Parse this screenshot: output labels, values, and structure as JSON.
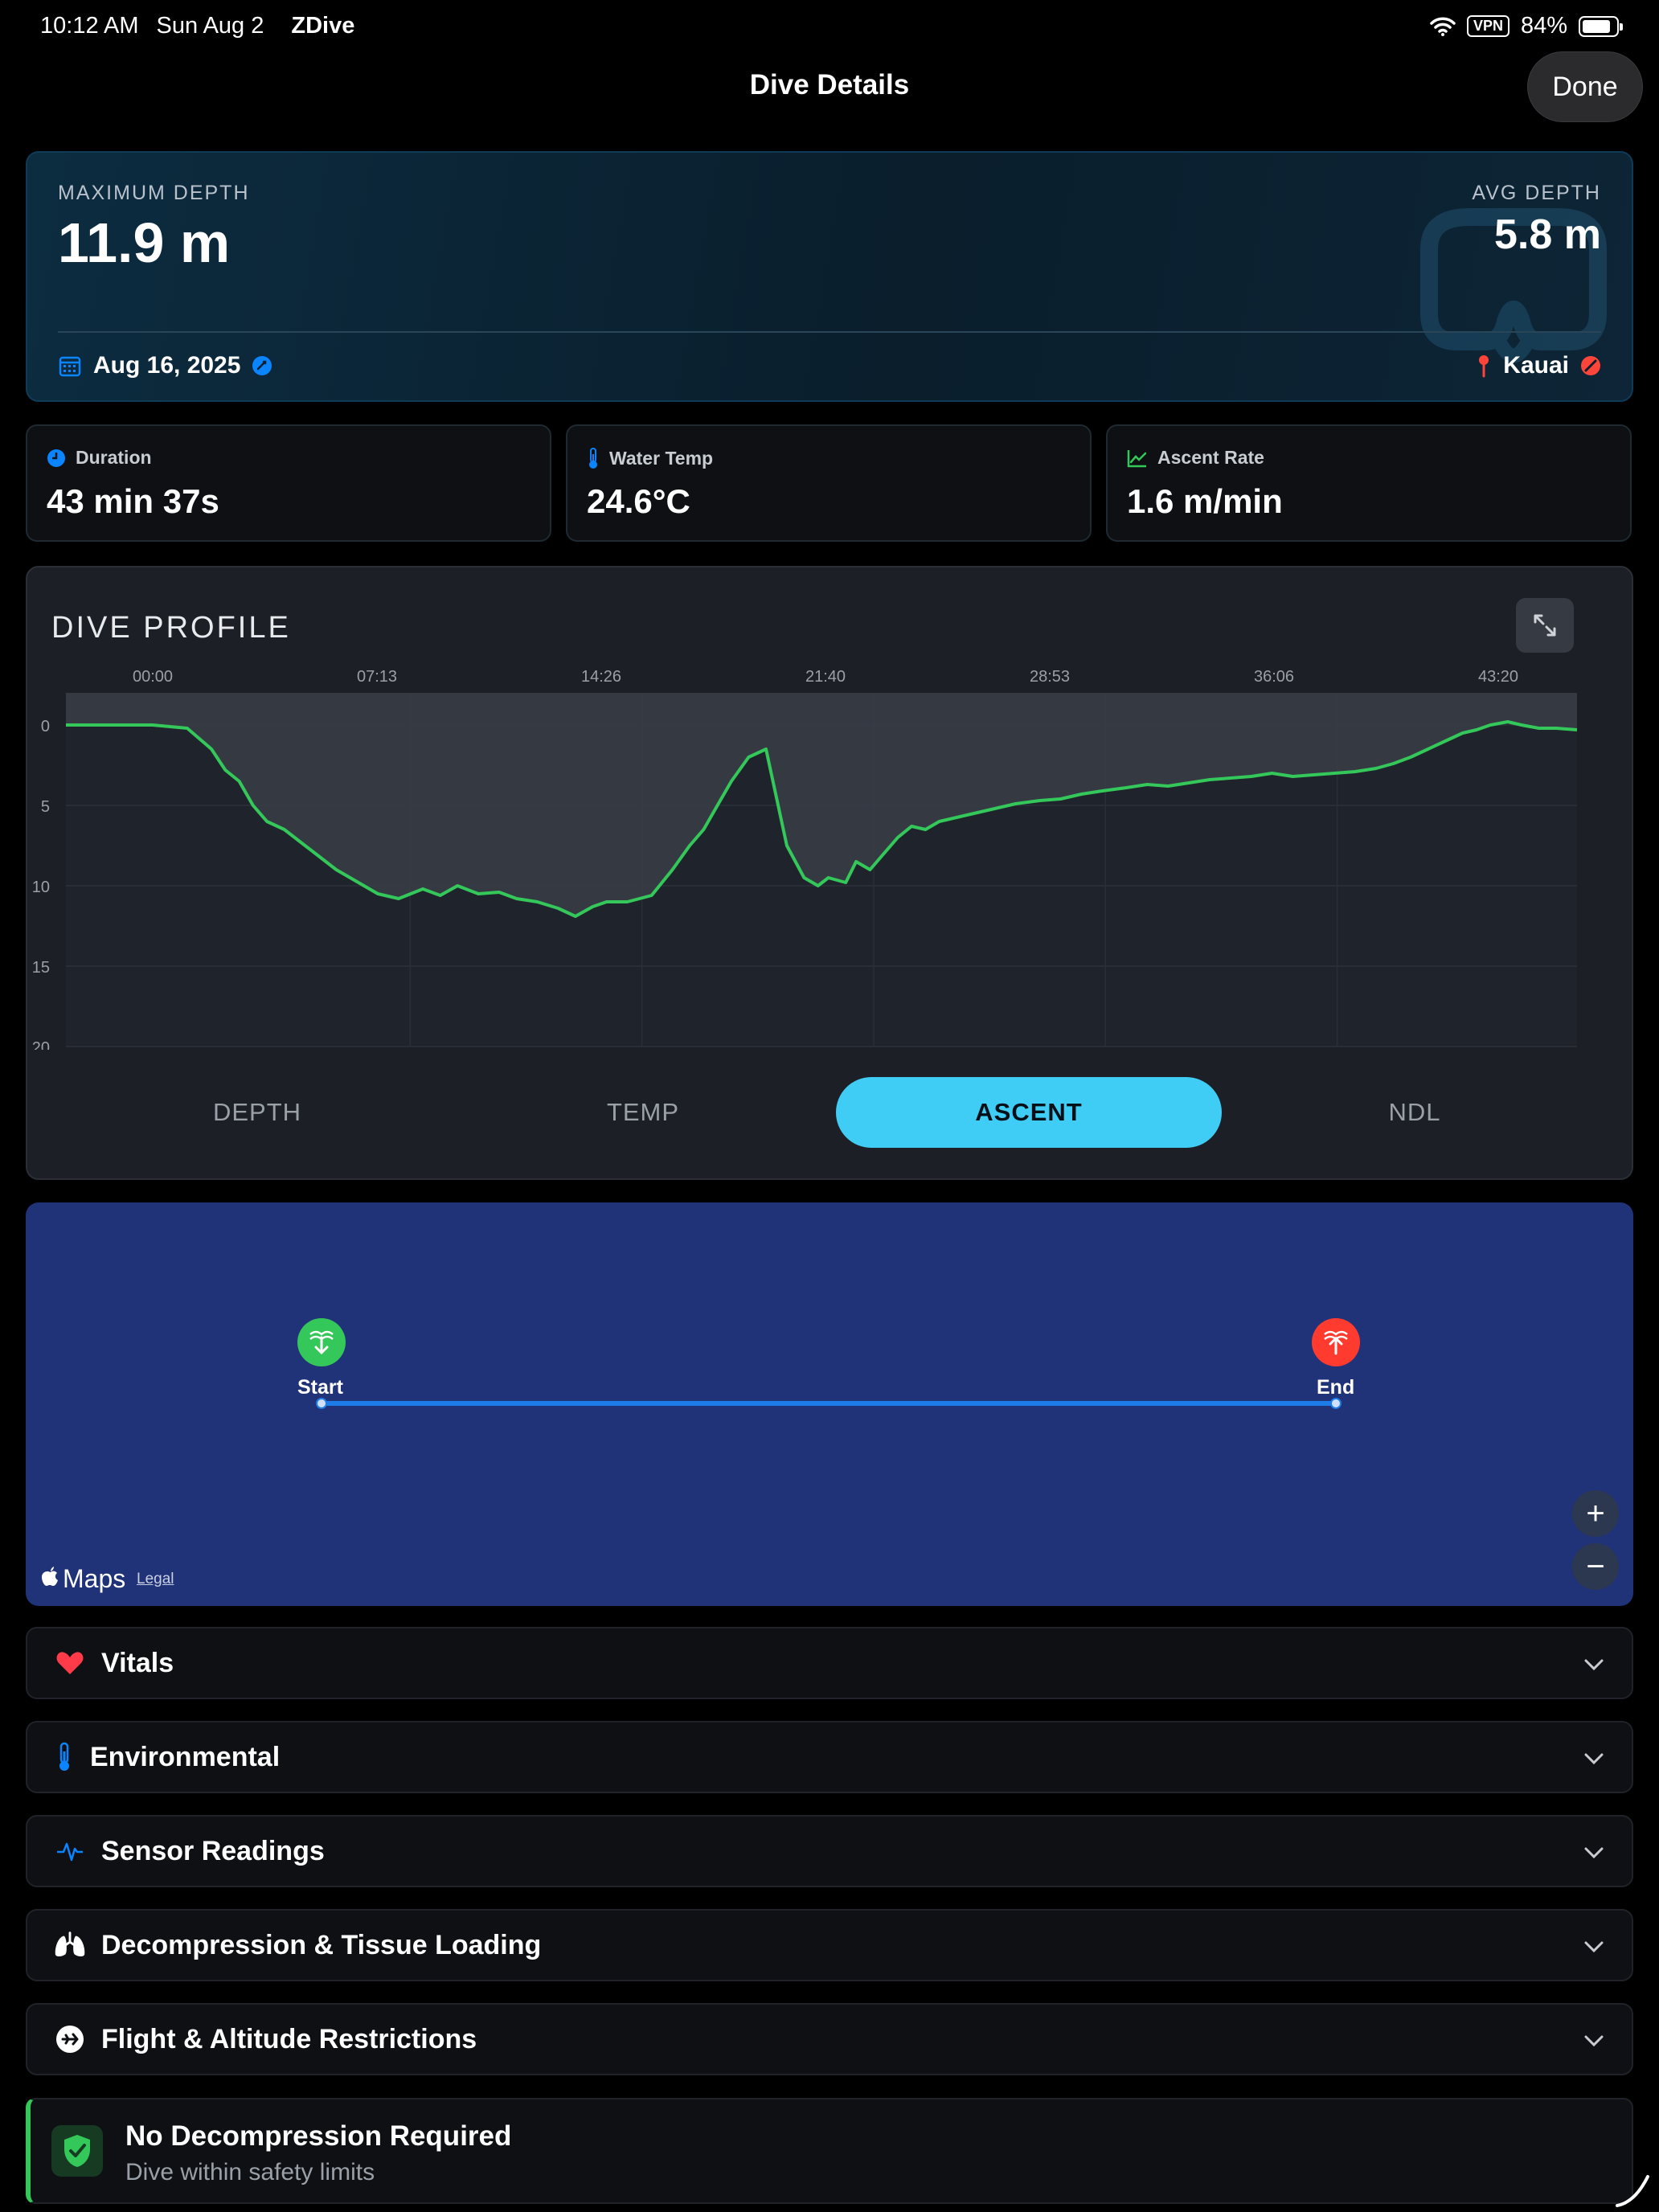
{
  "status_bar": {
    "time": "10:12 AM",
    "date": "Sun Aug 2",
    "app": "ZDive",
    "vpn": "VPN",
    "battery": "84%",
    "battery_level": 0.84
  },
  "header": {
    "title": "Dive Details",
    "done_label": "Done"
  },
  "hero": {
    "max_depth_label": "MAXIMUM DEPTH",
    "max_depth_value": "11.9 m",
    "avg_depth_label": "AVG DEPTH",
    "avg_depth_value": "5.8 m",
    "date": "Aug 16, 2025",
    "location": "Kauai",
    "accent_color": "#0a84ff",
    "location_color": "#ff453a"
  },
  "stats": [
    {
      "label": "Duration",
      "value": "43 min 37s",
      "icon": "clock-icon",
      "color": "#0a84ff"
    },
    {
      "label": "Water Temp",
      "value": "24.6°C",
      "icon": "thermometer-icon",
      "color": "#0a84ff"
    },
    {
      "label": "Ascent Rate",
      "value": "1.6 m/min",
      "icon": "trend-up-icon",
      "color": "#34c759"
    }
  ],
  "profile": {
    "title": "DIVE PROFILE",
    "tabs": [
      "DEPTH",
      "TEMP",
      "ASCENT",
      "NDL"
    ],
    "active_tab": "ASCENT",
    "active_color": "#40cdf5"
  },
  "chart_data": {
    "type": "area",
    "x_tick_labels": [
      "00:00",
      "07:13",
      "14:26",
      "21:40",
      "28:53",
      "36:06",
      "43:20"
    ],
    "y_tick_labels": [
      "0",
      "5",
      "10",
      "15",
      "20"
    ],
    "ylim": [
      -2,
      20
    ],
    "xlim": [
      0,
      43.6
    ],
    "y_inverted": true,
    "line_color": "#34c759",
    "grid": true,
    "series": [
      {
        "x": [
          0,
          1.5,
          2.5,
          3.5,
          4.2,
          4.6,
          5.0,
          5.4,
          5.8,
          6.3,
          6.9,
          7.2,
          7.5,
          7.8,
          8.2,
          8.6,
          9.0,
          9.6,
          10.3,
          10.8,
          11.3,
          11.9,
          12.5,
          13.0,
          13.6,
          14.2,
          14.7,
          15.2,
          15.6,
          16.2,
          16.9,
          17.5,
          18.0,
          18.4,
          18.8,
          19.2,
          19.7,
          20.2,
          20.8,
          21.3,
          21.7,
          22.0,
          22.5,
          22.8,
          23.2,
          23.6,
          24.0,
          24.4,
          24.8,
          25.2,
          25.6,
          26.2,
          26.8,
          27.4,
          28.1,
          28.7,
          29.3,
          29.9,
          30.6,
          31.2,
          31.8,
          32.4,
          33.0,
          33.6,
          34.2,
          34.8,
          35.4,
          36.0,
          36.6,
          37.2,
          37.8,
          38.3,
          38.8,
          39.3,
          39.8,
          40.3,
          40.7,
          41.1,
          41.6,
          42.0,
          42.5,
          43.0,
          43.6
        ],
        "y": [
          0,
          0,
          0,
          0.2,
          1.5,
          2.8,
          3.5,
          5.0,
          6.0,
          6.5,
          7.5,
          8.0,
          8.5,
          9.0,
          9.5,
          10.0,
          10.5,
          10.8,
          10.2,
          10.6,
          10.0,
          10.5,
          10.4,
          10.8,
          11.0,
          11.4,
          11.9,
          11.3,
          11.0,
          11.0,
          10.6,
          9.0,
          7.5,
          6.5,
          5.0,
          3.5,
          2.0,
          1.5,
          7.5,
          9.5,
          10.0,
          9.5,
          9.8,
          8.5,
          9.0,
          8.0,
          7.0,
          6.3,
          6.5,
          6.0,
          5.8,
          5.5,
          5.2,
          4.9,
          4.7,
          4.6,
          4.3,
          4.1,
          3.9,
          3.7,
          3.8,
          3.6,
          3.4,
          3.3,
          3.2,
          3.0,
          3.2,
          3.1,
          3.0,
          2.9,
          2.7,
          2.4,
          2.0,
          1.5,
          1.0,
          0.5,
          0.3,
          0.0,
          -0.2,
          0.0,
          0.2,
          0.2,
          0.3
        ]
      }
    ]
  },
  "map": {
    "start_label": "Start",
    "end_label": "End",
    "maps_label": "Maps",
    "legal_label": "Legal",
    "zoom_in": "+",
    "zoom_out": "−",
    "background": "#213378",
    "route_color": "#1e7ce8",
    "start_color": "#34c759",
    "end_color": "#ff3b30"
  },
  "sections": [
    {
      "label": "Vitals",
      "icon": "heart-icon"
    },
    {
      "label": "Environmental",
      "icon": "thermometer-icon"
    },
    {
      "label": "Sensor Readings",
      "icon": "waveform-icon"
    },
    {
      "label": "Decompression & Tissue Loading",
      "icon": "lungs-icon"
    },
    {
      "label": "Flight & Altitude Restrictions",
      "icon": "airplane-icon"
    }
  ],
  "banner": {
    "title": "No Decompression Required",
    "subtitle": "Dive within safety limits",
    "color": "#34c759"
  }
}
